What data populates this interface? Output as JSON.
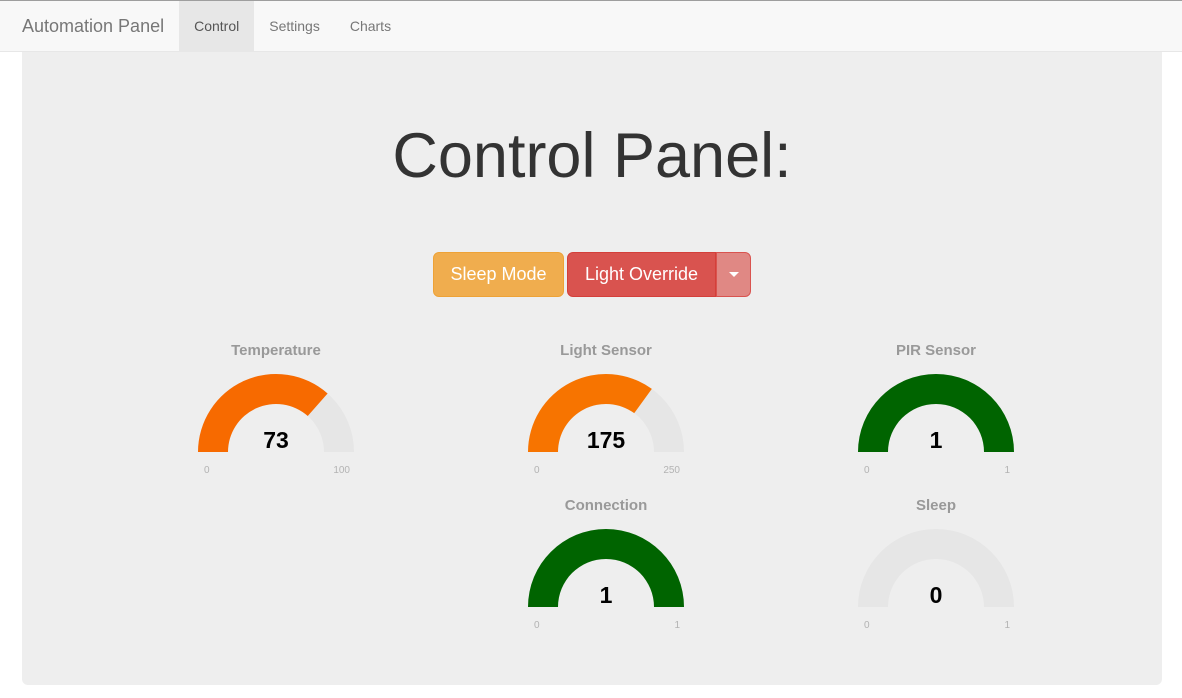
{
  "nav": {
    "brand": "Automation Panel",
    "items": [
      {
        "label": "Control",
        "active": true
      },
      {
        "label": "Settings",
        "active": false
      },
      {
        "label": "Charts",
        "active": false
      }
    ]
  },
  "main": {
    "title": "Control Panel:",
    "buttons": {
      "sleep_mode": "Sleep Mode",
      "light_override": "Light Override",
      "dropdown_icon": "caret-down-icon"
    }
  },
  "colors": {
    "warning": "#f0ad4e",
    "danger": "#d9534f",
    "gauge_orange": "#f77400",
    "gauge_green": "#006400",
    "gauge_track": "#e6e6e6"
  },
  "gauges": [
    {
      "id": "temperature",
      "title": "Temperature",
      "value": 73,
      "min": 0,
      "max": 100,
      "color": "#f76a00"
    },
    {
      "id": "light-sensor",
      "title": "Light Sensor",
      "value": 175,
      "min": 0,
      "max": 250,
      "color": "#f77400"
    },
    {
      "id": "pir-sensor",
      "title": "PIR Sensor",
      "value": 1,
      "min": 0,
      "max": 1,
      "color": "#006400"
    },
    {
      "id": "connection",
      "title": "Connection",
      "value": 1,
      "min": 0,
      "max": 1,
      "color": "#006400"
    },
    {
      "id": "sleep",
      "title": "Sleep",
      "value": 0,
      "min": 0,
      "max": 1,
      "color": "#006400"
    }
  ]
}
